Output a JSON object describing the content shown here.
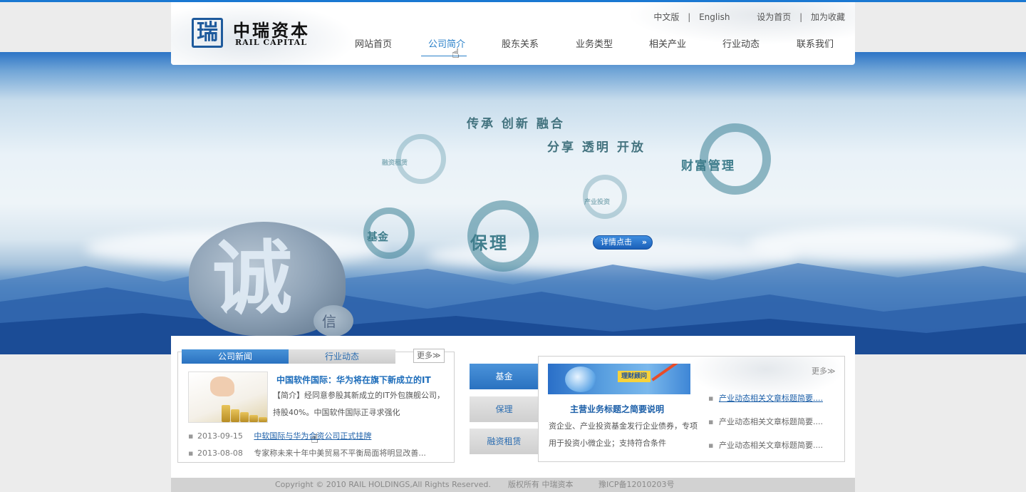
{
  "header": {
    "logo_mark": "瑞",
    "logo_cn": "中瑞资本",
    "logo_en": "RAIL CAPITAL",
    "lang_cn": "中文版",
    "lang_sep": "|",
    "lang_en": "English",
    "set_home": "设为首页",
    "link_sep": "|",
    "add_fav": "加为收藏"
  },
  "nav": {
    "items": [
      {
        "label": "网站首页"
      },
      {
        "label": "公司简介"
      },
      {
        "label": "股东关系"
      },
      {
        "label": "业务类型"
      },
      {
        "label": "相关产业"
      },
      {
        "label": "行业动态"
      },
      {
        "label": "联系我们"
      }
    ],
    "active_index": 1
  },
  "banner": {
    "slogan_line1": "传承 创新 融合",
    "slogan_line2": "分享 透明 开放",
    "ring_wealth": "财富管理",
    "ring_fund": "基金",
    "ring_factoring": "保理",
    "ring_faint1": "融资租赁",
    "ring_faint2": "产业投资",
    "stone_char": "诚",
    "stone_char2": "信",
    "detail_button": "详情点击",
    "detail_arrow": "»"
  },
  "news_panel": {
    "tab_company": "公司新闻",
    "tab_industry": "行业动态",
    "more": "更多≫",
    "feature_title": "中国软件国际：华为将在旗下新成立的IT",
    "feature_body": "【简介】经同意参股其新成立的IT外包旗舰公司，持股40%。中国软件国际正寻求强化",
    "items": [
      {
        "date": "2013-09-15",
        "title": "中软国际与华为合资公司正式挂牌"
      },
      {
        "date": "2013-08-08",
        "title": "专家称未来十年中美贸易不平衡局面将明显改善..."
      }
    ]
  },
  "side_buttons": {
    "fund": "基金",
    "factoring": "保理",
    "leasing": "融资租赁"
  },
  "business_panel": {
    "more": "更多≫",
    "image_badge": "理财顾问",
    "title": "主营业务标题之简要说明",
    "body": "资企业、产业投资基金发行企业债券，专项用于投资小微企业；支持符合条件",
    "items": [
      {
        "title": "产业动态相关文章标题简要...."
      },
      {
        "title": "产业动态相关文章标题简要...."
      },
      {
        "title": "产业动态相关文章标题简要...."
      }
    ]
  },
  "footer": {
    "copyright": "Copyright © 2010 RAIL HOLDINGS,All Rights Reserved.",
    "owner": "版权所有  中瑞资本",
    "icp": "豫ICP备12010203号"
  },
  "colors": {
    "accent": "#2a80c9",
    "top_line": "#1a78d2",
    "tab_active": "#2a72c0",
    "link": "#1c5fa8"
  }
}
